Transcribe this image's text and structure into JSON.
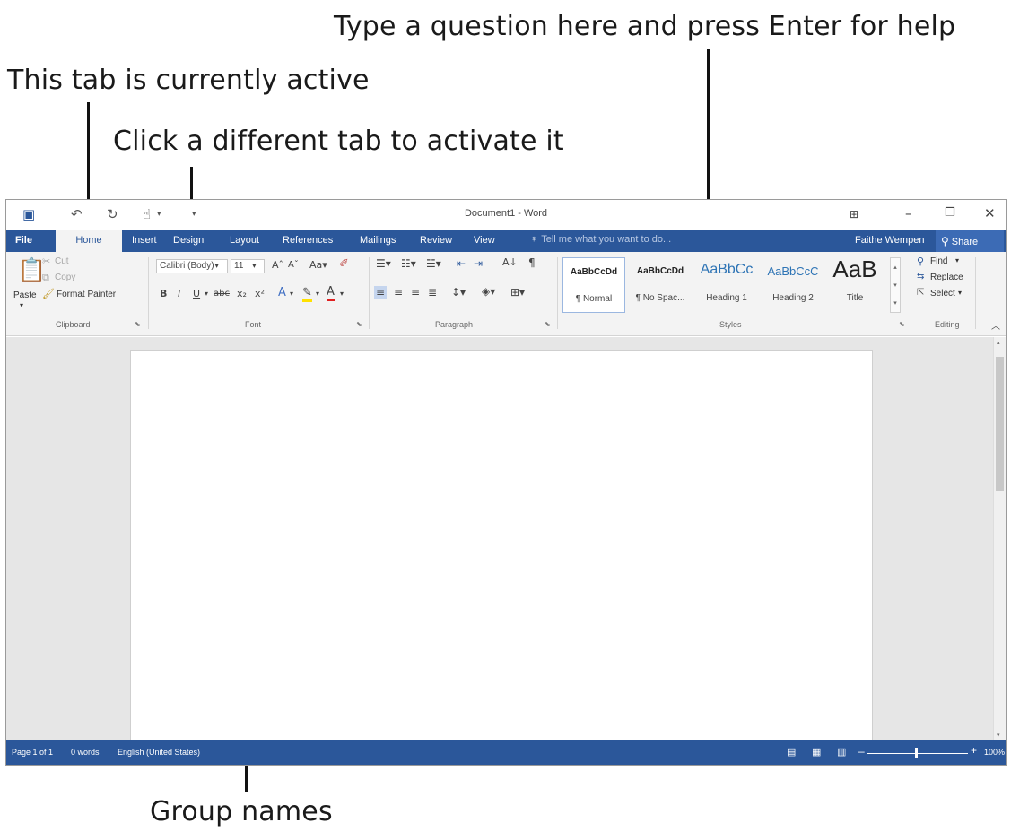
{
  "callouts": {
    "help": "Type a question here and press Enter for help",
    "active_tab": "This tab is currently active",
    "different_tab": "Click a different tab to activate it",
    "group_names": "Group names"
  },
  "window": {
    "title": "Document1 - Word",
    "qat_icons": [
      "save-icon",
      "undo-icon",
      "redo-icon",
      "touch-mode-icon",
      "customize-icon"
    ]
  },
  "tabs": {
    "file": "File",
    "home": "Home",
    "insert": "Insert",
    "design": "Design",
    "layout": "Layout",
    "references": "References",
    "mailings": "Mailings",
    "review": "Review",
    "view": "View"
  },
  "tell_me": "Tell me what you want to do...",
  "user_name": "Faithe Wempen",
  "share_label": "Share",
  "clipboard": {
    "paste": "Paste",
    "cut": "Cut",
    "copy": "Copy",
    "format_painter": "Format Painter",
    "label": "Clipboard"
  },
  "font": {
    "name": "Calibri (Body)",
    "size": "11",
    "label": "Font"
  },
  "paragraph": {
    "label": "Paragraph"
  },
  "styles": {
    "label": "Styles",
    "items": [
      {
        "sample": "AaBbCcDd",
        "name": "¶ Normal"
      },
      {
        "sample": "AaBbCcDd",
        "name": "¶ No Spac..."
      },
      {
        "sample": "AaBbCc",
        "name": "Heading 1"
      },
      {
        "sample": "AaBbCcC",
        "name": "Heading 2"
      },
      {
        "sample": "AaB",
        "name": "Title"
      }
    ]
  },
  "editing": {
    "find": "Find",
    "replace": "Replace",
    "select": "Select",
    "label": "Editing"
  },
  "status": {
    "page": "Page 1 of 1",
    "words": "0 words",
    "language": "English (United States)",
    "zoom": "100%"
  },
  "colors": {
    "accent": "#2b579a",
    "ribbon": "#f3f3f3"
  }
}
